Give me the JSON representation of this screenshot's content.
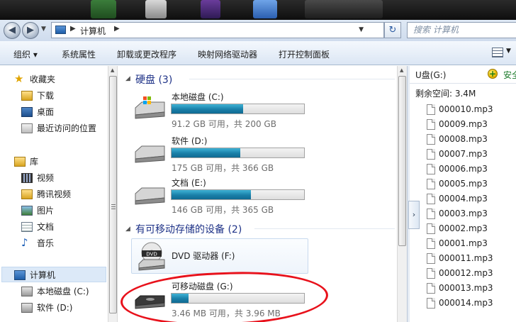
{
  "address": {
    "crumb": "计算机",
    "search_placeholder": "搜索 计算机"
  },
  "toolbar": {
    "organize": "组织 ▾",
    "system_properties": "系统属性",
    "uninstall": "卸载或更改程序",
    "map_drive": "映射网络驱动器",
    "control_panel": "打开控制面板"
  },
  "nav": {
    "favorites": "收藏夹",
    "downloads": "下载",
    "desktop": "桌面",
    "recent": "最近访问的位置",
    "libraries": "库",
    "videos": "视频",
    "tencent_video": "腾讯视频",
    "pictures": "图片",
    "documents": "文档",
    "music": "音乐",
    "computer": "计算机",
    "local_c": "本地磁盘 (C:)",
    "soft_d": "软件 (D:)"
  },
  "groups": {
    "hard_disks": "硬盘 (3)",
    "removable": "有可移动存储的设备 (2)"
  },
  "drives": [
    {
      "name": "本地磁盘 (C:)",
      "free": "91.2 GB 可用，共 200 GB",
      "used_fraction": 0.54
    },
    {
      "name": "软件 (D:)",
      "free": "175 GB 可用，共 366 GB",
      "used_fraction": 0.52
    },
    {
      "name": "文档 (E:)",
      "free": "146 GB 可用，共 365 GB",
      "used_fraction": 0.6
    },
    {
      "name": "DVD 驱动器 (F:)"
    },
    {
      "name": "可移动磁盘 (G:)",
      "free": "3.46 MB 可用，共 3.96 MB",
      "used_fraction": 0.13
    }
  ],
  "preview": {
    "title": "U盘(G:)",
    "action": "安全",
    "free_space": "剩余空间: 3.4M",
    "files": [
      "000010.mp3",
      "00009.mp3",
      "00008.mp3",
      "00007.mp3",
      "00006.mp3",
      "00005.mp3",
      "00004.mp3",
      "00003.mp3",
      "00002.mp3",
      "00001.mp3",
      "000011.mp3",
      "000012.mp3",
      "000013.mp3",
      "000014.mp3"
    ]
  },
  "colors": {
    "group_header": "#1e3287",
    "bar_fill": "#1a7fa8",
    "annotation": "#e8111b"
  }
}
